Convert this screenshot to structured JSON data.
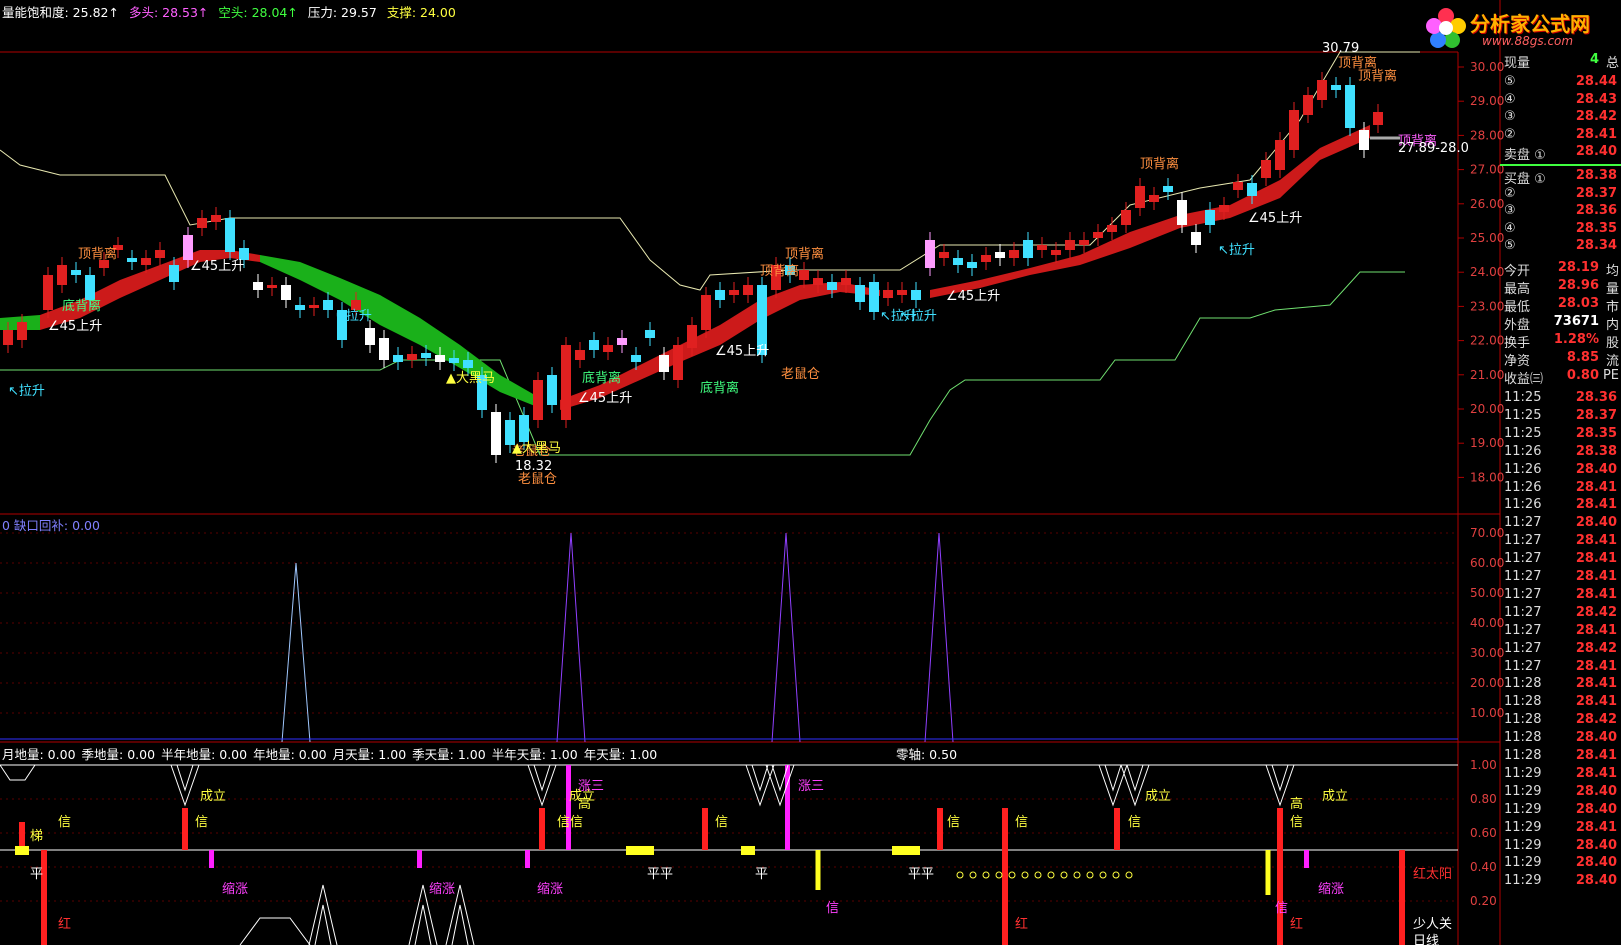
{
  "logo": {
    "title": "分析家公式网",
    "url_text": "www.88gs.com"
  },
  "top_legend": {
    "items": [
      {
        "label": "量能饱和度: 25.82↑",
        "color": "#ffffff"
      },
      {
        "label": "多头: 28.53↑",
        "color": "#ff60ff"
      },
      {
        "label": "空头: 28.04↑",
        "color": "#40ff40"
      },
      {
        "label": "压力: 29.57",
        "color": "#ffffff"
      },
      {
        "label": "支撑: 24.00",
        "color": "#ffff40"
      }
    ]
  },
  "mid_legend": {
    "label": "0 缺口回补: 0.00",
    "color": "#8080ff"
  },
  "bottom_legend": {
    "items": [
      {
        "label": "月地量: 0.00",
        "color": "#ffffff"
      },
      {
        "label": "季地量: 0.00",
        "color": "#ffffff"
      },
      {
        "label": "半年地量: 0.00",
        "color": "#ffffff"
      },
      {
        "label": "年地量: 0.00",
        "color": "#ffffff"
      },
      {
        "label": "月天量: 1.00",
        "color": "#ffffff"
      },
      {
        "label": "季天量: 1.00",
        "color": "#ffffff"
      },
      {
        "label": "半年天量: 1.00",
        "color": "#ffffff"
      },
      {
        "label": "年天量: 1.00",
        "color": "#ffffff"
      }
    ],
    "zero_axis": "零轴: 0.50"
  },
  "price_axis": [
    "30.00",
    "29.00",
    "28.00",
    "27.00",
    "26.00",
    "25.00",
    "24.00",
    "23.00",
    "22.00",
    "21.00",
    "20.00",
    "19.00",
    "18.00"
  ],
  "mid_axis": [
    "70.00",
    "60.00",
    "50.00",
    "40.00",
    "30.00",
    "20.00",
    "10.00"
  ],
  "bottom_axis": [
    "1.00",
    "0.80",
    "0.60",
    "0.40",
    "0.20"
  ],
  "price_labels": {
    "high": "30.79",
    "low": "18.32",
    "current_range": "27.89-28.0"
  },
  "annotations": {
    "top": [
      {
        "text": "顶背离",
        "color": "#ff9040"
      },
      {
        "text": "底背离",
        "color": "#40ff80"
      },
      {
        "text": "∠45上升",
        "color": "#ffffff"
      },
      {
        "text": "↖拉升",
        "color": "#40e0ff"
      },
      {
        "text": "▲大黑马",
        "color": "#ffff40"
      },
      {
        "text": "老鼠仓",
        "color": "#ff9040"
      },
      {
        "text": "顶背离",
        "color": "#ff9040"
      },
      {
        "text": "∠45上升",
        "color": "#ffffff"
      },
      {
        "text": "↖拉升",
        "color": "#40e0ff"
      },
      {
        "text": "↖拉升",
        "color": "#40e0ff"
      },
      {
        "text": "▲大黑马",
        "color": "#ffff40"
      },
      {
        "text": "底背离",
        "color": "#40ff80"
      },
      {
        "text": "∠45上升",
        "color": "#ffffff"
      },
      {
        "text": "顶背离",
        "color": "#ff9040"
      },
      {
        "text": "底背离",
        "color": "#40ff80"
      },
      {
        "text": "∠45上升",
        "color": "#ffffff"
      },
      {
        "text": "老鼠仓",
        "color": "#ff9040"
      },
      {
        "text": "∠45上升",
        "color": "#ffffff"
      },
      {
        "text": "↖拉升",
        "color": "#40e0ff"
      },
      {
        "text": "顶背离",
        "color": "#ff9040"
      },
      {
        "text": "∠45上升",
        "color": "#ffffff"
      },
      {
        "text": "↖拉升",
        "color": "#40e0ff"
      },
      {
        "text": "顶背离",
        "color": "#ff9040"
      },
      {
        "text": "顶背离",
        "color": "#ff9040"
      },
      {
        "text": "顶背离",
        "color": "#ff60ff"
      },
      {
        "text": "老鼠仓",
        "color": "#ff9040"
      }
    ],
    "bottom": [
      {
        "text": "梯",
        "color": "#ffff40"
      },
      {
        "text": "信",
        "color": "#ffff40"
      },
      {
        "text": "平",
        "color": "#ffffff"
      },
      {
        "text": "红",
        "color": "#ff3030"
      },
      {
        "text": "成立",
        "color": "#ffff40"
      },
      {
        "text": "信",
        "color": "#ffff40"
      },
      {
        "text": "缩涨",
        "color": "#ff40ff"
      },
      {
        "text": "缩涨",
        "color": "#ff40ff"
      },
      {
        "text": "缩涨",
        "color": "#ff40ff"
      },
      {
        "text": "信",
        "color": "#ffff40"
      },
      {
        "text": "涨三",
        "color": "#ff40ff"
      },
      {
        "text": "成立",
        "color": "#ffff40"
      },
      {
        "text": "信",
        "color": "#ffff40"
      },
      {
        "text": "平平",
        "color": "#ffffff"
      },
      {
        "text": "信",
        "color": "#ffff40"
      },
      {
        "text": "平",
        "color": "#ffffff"
      },
      {
        "text": "涨三",
        "color": "#ff40ff"
      },
      {
        "text": "信",
        "color": "#ff40ff"
      },
      {
        "text": "平平",
        "color": "#ffffff"
      },
      {
        "text": "信",
        "color": "#ffff40"
      },
      {
        "text": "信",
        "color": "#ffff40"
      },
      {
        "text": "红",
        "color": "#ff3030"
      },
      {
        "text": "信",
        "color": "#ffff40"
      },
      {
        "text": "成立",
        "color": "#ffff40"
      },
      {
        "text": "高",
        "color": "#ffff40"
      },
      {
        "text": "成立",
        "color": "#ffff40"
      },
      {
        "text": "信",
        "color": "#ffff40"
      },
      {
        "text": "缩涨",
        "color": "#ff40ff"
      },
      {
        "text": "信",
        "color": "#ff40ff"
      },
      {
        "text": "红",
        "color": "#ff3030"
      },
      {
        "text": "红太阳",
        "color": "#ff3030"
      },
      {
        "text": "少人关",
        "color": "#ffffff"
      },
      {
        "text": "高",
        "color": "#ffff40"
      },
      {
        "text": "日线",
        "color": "#ffffff"
      }
    ]
  },
  "quote": {
    "header": {
      "label": "现量",
      "value": "4",
      "extra": "总"
    },
    "sell": [
      {
        "label": "⑤",
        "value": "28.44"
      },
      {
        "label": "④",
        "value": "28.43"
      },
      {
        "label": "③",
        "value": "28.42"
      },
      {
        "label": "②",
        "value": "28.41"
      },
      {
        "label": "卖盘 ①",
        "value": "28.40"
      }
    ],
    "buy": [
      {
        "label": "买盘 ①",
        "value": "28.38"
      },
      {
        "label": "②",
        "value": "28.37"
      },
      {
        "label": "③",
        "value": "28.36"
      },
      {
        "label": "④",
        "value": "28.35"
      },
      {
        "label": "⑤",
        "value": "28.34"
      }
    ],
    "stats": [
      {
        "label": "今开",
        "value": "28.19",
        "extra": "均"
      },
      {
        "label": "最高",
        "value": "28.96",
        "extra": "量"
      },
      {
        "label": "最低",
        "value": "28.03",
        "extra": "市"
      },
      {
        "label": "外盘",
        "value": "73671",
        "extra": "内"
      },
      {
        "label": "换手",
        "value": "1.28%",
        "extra": "股"
      },
      {
        "label": "净资",
        "value": "8.85",
        "extra": "流"
      },
      {
        "label": "收益㈢",
        "value": "0.80",
        "extra": "PE"
      }
    ],
    "ticks": [
      {
        "time": "11:25",
        "price": "28.36"
      },
      {
        "time": "11:25",
        "price": "28.37"
      },
      {
        "time": "11:25",
        "price": "28.35"
      },
      {
        "time": "11:26",
        "price": "28.38"
      },
      {
        "time": "11:26",
        "price": "28.40"
      },
      {
        "time": "11:26",
        "price": "28.41"
      },
      {
        "time": "11:26",
        "price": "28.41"
      },
      {
        "time": "11:27",
        "price": "28.40"
      },
      {
        "time": "11:27",
        "price": "28.41"
      },
      {
        "time": "11:27",
        "price": "28.41"
      },
      {
        "time": "11:27",
        "price": "28.41"
      },
      {
        "time": "11:27",
        "price": "28.41"
      },
      {
        "time": "11:27",
        "price": "28.42"
      },
      {
        "time": "11:27",
        "price": "28.41"
      },
      {
        "time": "11:27",
        "price": "28.42"
      },
      {
        "time": "11:27",
        "price": "28.41"
      },
      {
        "time": "11:28",
        "price": "28.41"
      },
      {
        "time": "11:28",
        "price": "28.41"
      },
      {
        "time": "11:28",
        "price": "28.42"
      },
      {
        "time": "11:28",
        "price": "28.40"
      },
      {
        "time": "11:28",
        "price": "28.41"
      },
      {
        "time": "11:29",
        "price": "28.41"
      },
      {
        "time": "11:29",
        "price": "28.40"
      },
      {
        "time": "11:29",
        "price": "28.40"
      },
      {
        "time": "11:29",
        "price": "28.41"
      },
      {
        "time": "11:29",
        "price": "28.40"
      },
      {
        "time": "11:29",
        "price": "28.40"
      },
      {
        "time": "11:29",
        "price": "28.40"
      }
    ]
  },
  "colors": {
    "up": "#ff3030",
    "down": "#40e0ff",
    "grid": "#8b0000",
    "axis_text": "#e04040"
  }
}
